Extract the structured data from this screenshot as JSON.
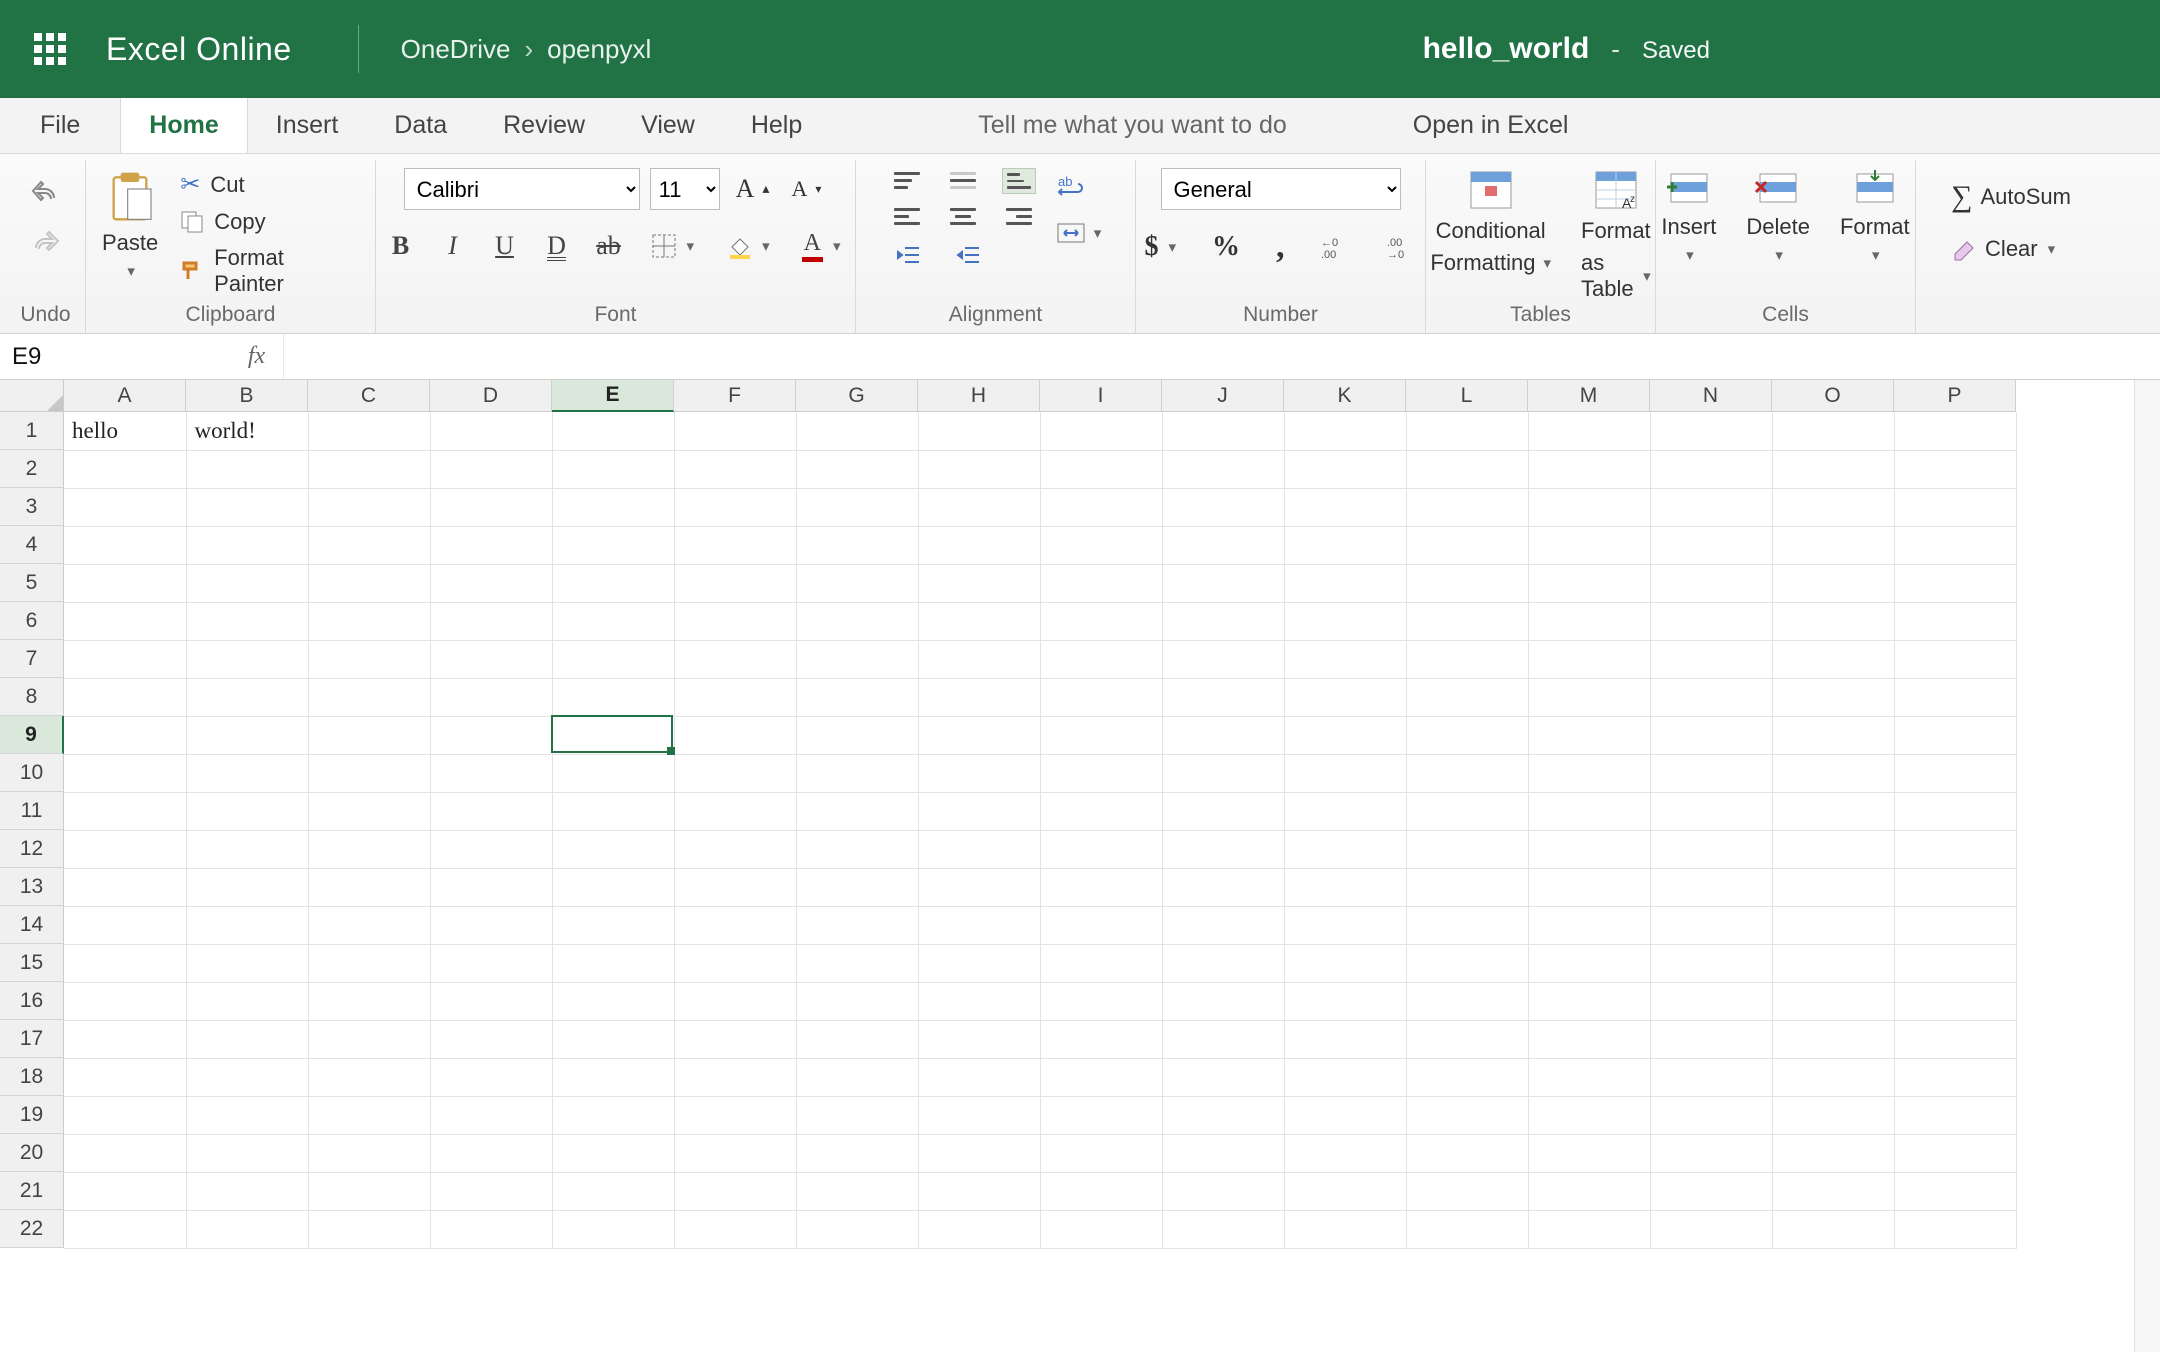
{
  "header": {
    "brand": "Excel Online",
    "breadcrumb_root": "OneDrive",
    "breadcrumb_child": "openpyxl",
    "doc_name": "hello_world",
    "saved_label": "Saved"
  },
  "tabs": {
    "file": "File",
    "home": "Home",
    "insert": "Insert",
    "data": "Data",
    "review": "Review",
    "view": "View",
    "help": "Help",
    "tellme": "Tell me what you want to do",
    "open_in_excel": "Open in Excel"
  },
  "ribbon": {
    "undo_group": "Undo",
    "clipboard": {
      "paste": "Paste",
      "cut": "Cut",
      "copy": "Copy",
      "format_painter": "Format Painter",
      "group": "Clipboard"
    },
    "font": {
      "name_value": "Calibri",
      "size_value": "11",
      "group": "Font"
    },
    "alignment": {
      "group": "Alignment"
    },
    "number": {
      "format_value": "General",
      "group": "Number"
    },
    "tables": {
      "cond_fmt_line1": "Conditional",
      "cond_fmt_line2": "Formatting",
      "fmt_table_line1": "Format",
      "fmt_table_line2": "as Table",
      "group": "Tables"
    },
    "cells": {
      "insert": "Insert",
      "delete": "Delete",
      "format": "Format",
      "group": "Cells"
    },
    "editing": {
      "autosum": "AutoSum",
      "clear": "Clear"
    }
  },
  "formula_bar": {
    "namebox_value": "E9",
    "fx_label": "fx",
    "formula_value": ""
  },
  "grid": {
    "columns": [
      "A",
      "B",
      "C",
      "D",
      "E",
      "F",
      "G",
      "H",
      "I",
      "J",
      "K",
      "L",
      "M",
      "N",
      "O",
      "P"
    ],
    "rows": [
      1,
      2,
      3,
      4,
      5,
      6,
      7,
      8,
      9,
      10,
      11,
      12,
      13,
      14,
      15,
      16,
      17,
      18,
      19,
      20,
      21,
      22
    ],
    "active_col": "E",
    "active_row": 9,
    "cells": {
      "A1": "hello",
      "B1": "world!"
    }
  }
}
